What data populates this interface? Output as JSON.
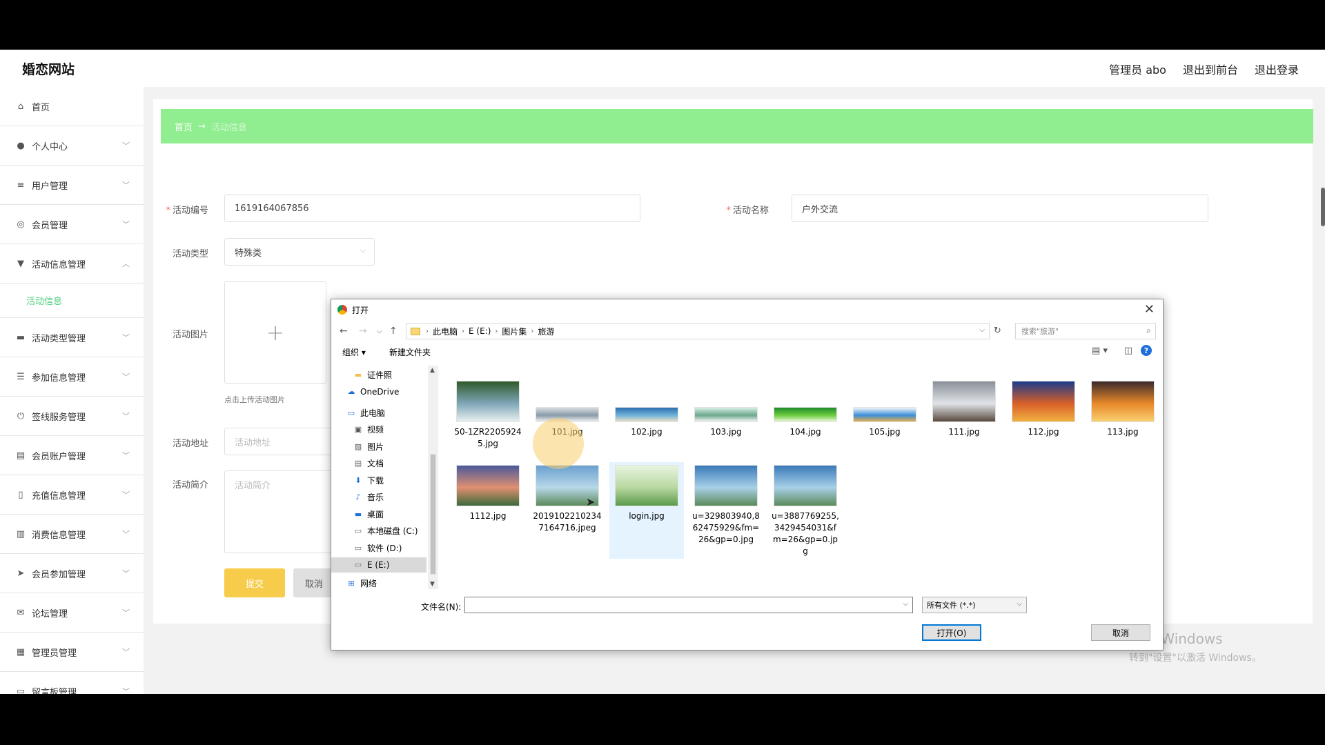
{
  "app": {
    "brand": "婚恋网站",
    "user_label": "管理员 abo",
    "to_frontend": "退出到前台",
    "logout": "退出登录"
  },
  "sidebar": {
    "items": [
      {
        "label": "首页",
        "icon": "home-icon",
        "glyph": "⌂"
      },
      {
        "label": "个人中心",
        "icon": "user-icon",
        "glyph": "●"
      },
      {
        "label": "用户管理",
        "icon": "sliders-icon",
        "glyph": "≡"
      },
      {
        "label": "会员管理",
        "icon": "compass-icon",
        "glyph": "◎"
      },
      {
        "label": "活动信息管理",
        "icon": "flag-icon",
        "glyph": "▼"
      },
      {
        "label": "活动类型管理",
        "icon": "monitor-icon",
        "glyph": "▬"
      },
      {
        "label": "参加信息管理",
        "icon": "list-icon",
        "glyph": "☰"
      },
      {
        "label": "签线服务管理",
        "icon": "power-icon",
        "glyph": "⏻"
      },
      {
        "label": "会员账户管理",
        "icon": "clipboard-icon",
        "glyph": "▤"
      },
      {
        "label": "充值信息管理",
        "icon": "phone-icon",
        "glyph": "▯"
      },
      {
        "label": "消费信息管理",
        "icon": "bar-chart-icon",
        "glyph": "▥"
      },
      {
        "label": "会员参加管理",
        "icon": "send-icon",
        "glyph": "➤"
      },
      {
        "label": "论坛管理",
        "icon": "mail-icon",
        "glyph": "✉"
      },
      {
        "label": "管理员管理",
        "icon": "grid-icon",
        "glyph": "▦"
      },
      {
        "label": "留言板管理",
        "icon": "message-icon",
        "glyph": "▭"
      }
    ],
    "sub_active": "活动信息"
  },
  "breadcrumb": {
    "home": "首页",
    "arrow": "→",
    "current": "活动信息"
  },
  "form": {
    "code_label": "活动编号",
    "code_value": "1619164067856",
    "name_label": "活动名称",
    "name_value": "户外交流",
    "type_label": "活动类型",
    "type_value": "特殊类",
    "image_label": "活动图片",
    "upload_plus": "+",
    "upload_hint": "点击上传活动图片",
    "address_label": "活动地址",
    "address_placeholder": "活动地址",
    "intro_label": "活动简介",
    "intro_placeholder": "活动简介",
    "submit": "提交",
    "cancel": "取消"
  },
  "watermark": {
    "line1": "激活 Windows",
    "line2": "转到\"设置\"以激活 Windows。"
  },
  "dialog": {
    "title": "打开",
    "close": "✕",
    "path": [
      "此电脑",
      "E (E:)",
      "图片集",
      "旅游"
    ],
    "search_placeholder": "搜索\"旅游\"",
    "organize": "组织 ▾",
    "new_folder": "新建文件夹",
    "help": "?",
    "tree": [
      {
        "label": "证件照",
        "icon": "folder-icon",
        "indent": 1
      },
      {
        "label": "OneDrive",
        "icon": "cloud-icon",
        "indent": 0
      },
      {
        "label": "此电脑",
        "icon": "computer-icon",
        "indent": 0
      },
      {
        "label": "视频",
        "icon": "video-icon",
        "indent": 1
      },
      {
        "label": "图片",
        "icon": "picture-icon",
        "indent": 1
      },
      {
        "label": "文档",
        "icon": "document-icon",
        "indent": 1
      },
      {
        "label": "下载",
        "icon": "download-icon",
        "indent": 1
      },
      {
        "label": "音乐",
        "icon": "music-icon",
        "indent": 1
      },
      {
        "label": "桌面",
        "icon": "desktop-icon",
        "indent": 1
      },
      {
        "label": "本地磁盘 (C:)",
        "icon": "drive-icon",
        "indent": 1
      },
      {
        "label": "软件 (D:)",
        "icon": "drive-icon",
        "indent": 1
      },
      {
        "label": "E (E:)",
        "icon": "drive-icon",
        "indent": 1,
        "selected": true
      },
      {
        "label": "网络",
        "icon": "network-icon",
        "indent": 0
      }
    ],
    "files": [
      {
        "name": "50-1ZR22059245.jpg",
        "colors": [
          "#2e5a2a",
          "#7fa6b8",
          "#e8f0f0"
        ]
      },
      {
        "name": "101.jpg",
        "colors": [
          "#d8dde0",
          "#8a9aa8",
          "#f0f0f0"
        ]
      },
      {
        "name": "102.jpg",
        "colors": [
          "#2b6fb0",
          "#6fb2d8",
          "#e8e0c8"
        ]
      },
      {
        "name": "103.jpg",
        "colors": [
          "#d8efe8",
          "#6aa88c",
          "#f4f4f4"
        ]
      },
      {
        "name": "104.jpg",
        "colors": [
          "#1e8a2a",
          "#6ccd3e",
          "#eaf6d8"
        ]
      },
      {
        "name": "105.jpg",
        "colors": [
          "#f2f6fa",
          "#3c8ed8",
          "#e8b050"
        ]
      },
      {
        "name": "111.jpg",
        "colors": [
          "#8a9098",
          "#e0e4e8",
          "#5a4a40"
        ]
      },
      {
        "name": "112.jpg",
        "colors": [
          "#1a3a8a",
          "#d8602a",
          "#f0b040"
        ]
      },
      {
        "name": "113.jpg",
        "colors": [
          "#3a2a2a",
          "#e8882a",
          "#f8d070"
        ]
      },
      {
        "name": "1112.jpg",
        "colors": [
          "#4a5a9a",
          "#e09070",
          "#3a6a3a"
        ]
      },
      {
        "name": "20191022102347164716.jpeg",
        "colors": [
          "#6aa0d0",
          "#b8d8e8",
          "#5a8a5a"
        ]
      },
      {
        "name": "login.jpg",
        "colors": [
          "#e8f4e0",
          "#b8d8a0",
          "#5a9a4a"
        ]
      },
      {
        "name": "u=329803940,862475929&fm=26&gp=0.jpg",
        "colors": [
          "#3a7ab8",
          "#a8d0e8",
          "#5a8a5a"
        ]
      },
      {
        "name": "u=3887769255,3429454031&fm=26&gp=0.jpg",
        "colors": [
          "#3a7ab8",
          "#a8d0e8",
          "#5a8a5a"
        ]
      }
    ],
    "filename_label": "文件名(N):",
    "filename_value": "",
    "filetype": "所有文件 (*.*)",
    "open": "打开(O)",
    "cancel": "取消"
  }
}
